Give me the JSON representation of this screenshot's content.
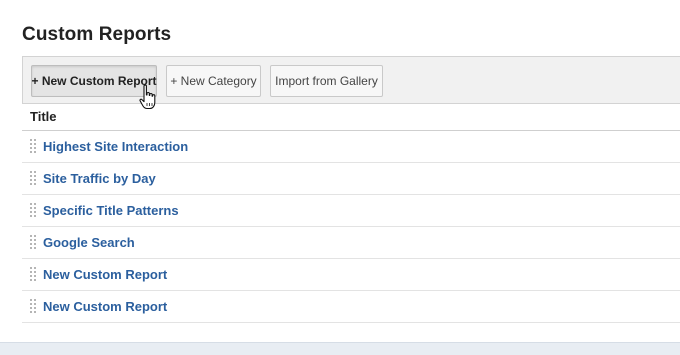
{
  "page": {
    "title": "Custom Reports"
  },
  "toolbar": {
    "new_custom_report_label": "+ New Custom Report",
    "new_category_label": "+ New Category",
    "import_gallery_label": "Import from Gallery"
  },
  "table": {
    "column_title": "Title",
    "rows": [
      {
        "title": "Highest Site Interaction"
      },
      {
        "title": "Site Traffic by Day"
      },
      {
        "title": "Specific Title Patterns"
      },
      {
        "title": "Google Search"
      },
      {
        "title": "New Custom Report"
      },
      {
        "title": "New Custom Report"
      }
    ]
  },
  "colors": {
    "link": "#2b5f9e",
    "toolbar_bg": "#f1f1f1",
    "page_bg": "#e8edf3"
  },
  "icons": {
    "drag_handle": "drag-handle-icon",
    "cursor": "hand-pointer-icon"
  }
}
